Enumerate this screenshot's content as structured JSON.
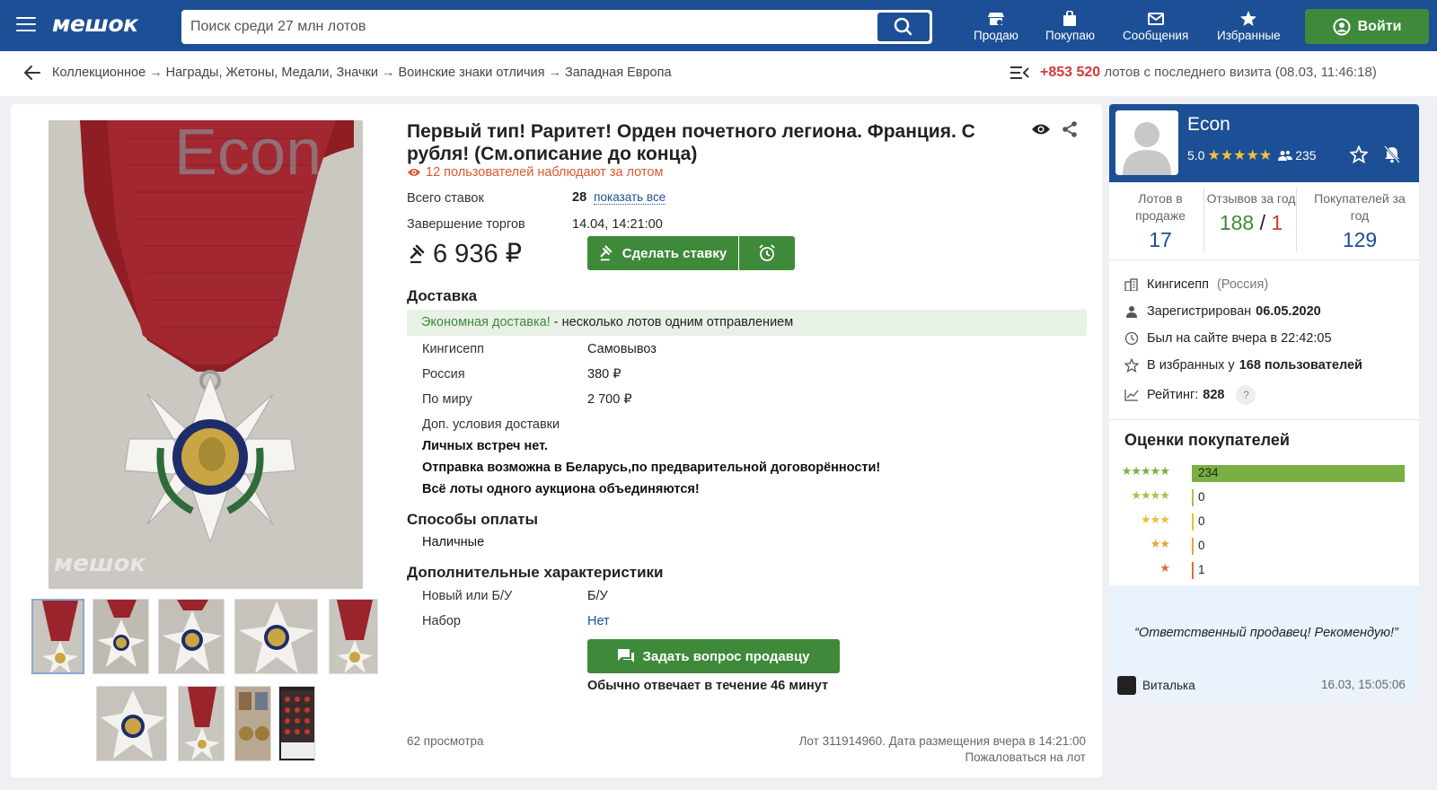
{
  "header": {
    "logo": "мешок",
    "search_placeholder": "Поиск среди 27 млн лотов",
    "nav": [
      "Продаю",
      "Покупаю",
      "Сообщения",
      "Избранные"
    ],
    "login": "Войти",
    "accent": "#1c4f95",
    "button_green": "#3e8a3a"
  },
  "breadcrumb": {
    "items": [
      "Коллекционное",
      "Награды, Жетоны, Медали, Значки",
      "Воинские знаки отличия",
      "Западная Европа"
    ],
    "separator": "→",
    "new_lots_count": "+853 520",
    "new_lots_text": "лотов с последнего визита (08.03, 11:46:18)"
  },
  "lot": {
    "title": "Первый тип! Раритет! Орден почетного легиона. Франция. С рубля! (См.описание до конца)",
    "watchers": "12 пользователей наблюдают за лотом",
    "bids_label": "Всего ставок",
    "bids_value": "28",
    "show_all": "показать все",
    "end_label": "Завершение торгов",
    "end_value": "14.04, 14:21:00",
    "price": "6 936 ₽",
    "bid_button": "Сделать ставку",
    "image_watermark": "Econ",
    "image_logo": "мешок",
    "thumbnail_count": 9
  },
  "delivery": {
    "heading": "Доставка",
    "eco_label": "Экономная доставка!",
    "eco_text": "- несколько лотов одним отправлением",
    "rows": [
      {
        "label": "Кингисепп",
        "value": "Самовывоз"
      },
      {
        "label": "Россия",
        "value": "380 ₽"
      },
      {
        "label": "По миру",
        "value": "2 700 ₽"
      }
    ],
    "extra_label": "Доп. условия доставки",
    "conditions": [
      "Личных встреч нет.",
      "Отправка возможна в Беларусь,по предварительной договорённости!",
      "Всё лоты одного аукциона объединяются!"
    ]
  },
  "payment": {
    "heading": "Способы оплаты",
    "value": "Наличные"
  },
  "characteristics": {
    "heading": "Дополнительные характеристики",
    "rows": [
      {
        "label": "Новый или Б/У",
        "value": "Б/У"
      },
      {
        "label": "Набор",
        "value": "Нет"
      }
    ]
  },
  "ask": {
    "button": "Задать вопрос продавцу",
    "response": "Обычно отвечает в течение 46 минут"
  },
  "footer": {
    "views": "62 просмотра",
    "lot_info": "Лот 311914960. Дата размещения вчера в 14:21:00",
    "complain": "Пожаловаться на лот"
  },
  "seller": {
    "name": "Econ",
    "rating": "5.0",
    "stars": "★★★★★",
    "followers": "235",
    "stats": [
      {
        "label": "Лотов в продаже",
        "value": "17"
      },
      {
        "label": "Отзывов за год",
        "pos": "188",
        "sep": "/",
        "neg": "1"
      },
      {
        "label": "Покупателей за год",
        "value": "129"
      }
    ],
    "city": "Кингисепп",
    "country": "(Россия)",
    "registered_label": "Зарегистрирован",
    "registered_date": "06.05.2020",
    "last_seen": "Был на сайте вчера в 22:42:05",
    "favorites_text": "В избранных у",
    "favorites_count": "168 пользователей",
    "rating_label": "Рейтинг:",
    "rating_value": "828",
    "help": "?"
  },
  "reviews": {
    "heading": "Оценки покупателей",
    "rows": [
      {
        "stars": "★★★★★",
        "count": "234",
        "fraction": 1.0,
        "color": "#7ab041"
      },
      {
        "stars": "★★★★",
        "count": "0",
        "fraction": 0,
        "color": "#a6c24a"
      },
      {
        "stars": "★★★",
        "count": "0",
        "fraction": 0,
        "color": "#e6c13a"
      },
      {
        "stars": "★★",
        "count": "0",
        "fraction": 0,
        "color": "#eaa33a"
      },
      {
        "stars": "★",
        "count": "1",
        "fraction": 0.004,
        "color": "#e36b3a"
      }
    ],
    "quote": "“Ответственный продавец! Рекомендую!”",
    "reviewer": "Виталька",
    "date": "16.03, 15:05:06"
  }
}
